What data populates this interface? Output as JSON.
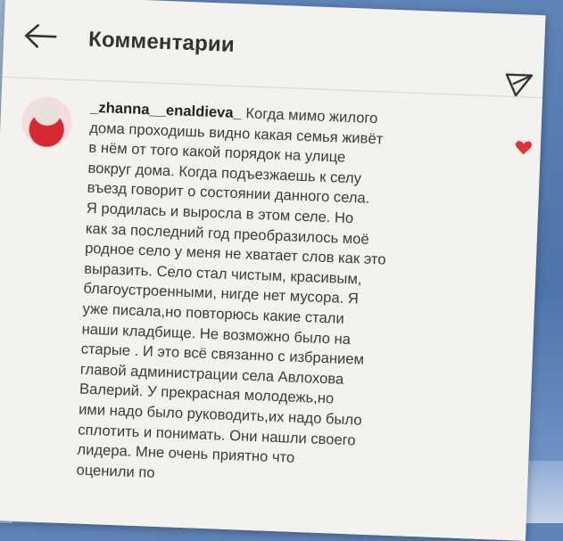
{
  "header": {
    "title": "Комментарии",
    "back_icon": "arrow-left-icon",
    "send_icon": "paper-plane-icon"
  },
  "comment": {
    "username": "_zhanna__enaldieva_",
    "text": "Когда мимо жилого\nдома проходишь видно какая семья живёт\nв нём от того какой порядок на улице\nвокруг дома. Когда подъезжаешь к селу\nвъезд говорит о состоянии данного села.\nЯ родилась и выросла в этом селе. Но\nкак за последний год преобразилось моё\nродное село у меня не хватает слов как это\nвыразить. Село стал чистым, красивым,\nблагоустроенными, нигде нет мусора. Я\nуже писала,но повторюсь какие стали\nнаши кладбище. Не возможно было на\nстарые . И это всё связанно с избранием\nглавой администрации села Авлохова\nВалерий. У прекрасная молодежь,но\nими надо было руководить,их надо было\nсплотить и понимать. Они нашли своего\nлидера. Мне очень приятно что\nоценили по",
    "like_icon": "heart-icon"
  },
  "colors": {
    "heart": "#e0303a",
    "paper": "#f4f2ef",
    "background": "#5f84b8"
  }
}
